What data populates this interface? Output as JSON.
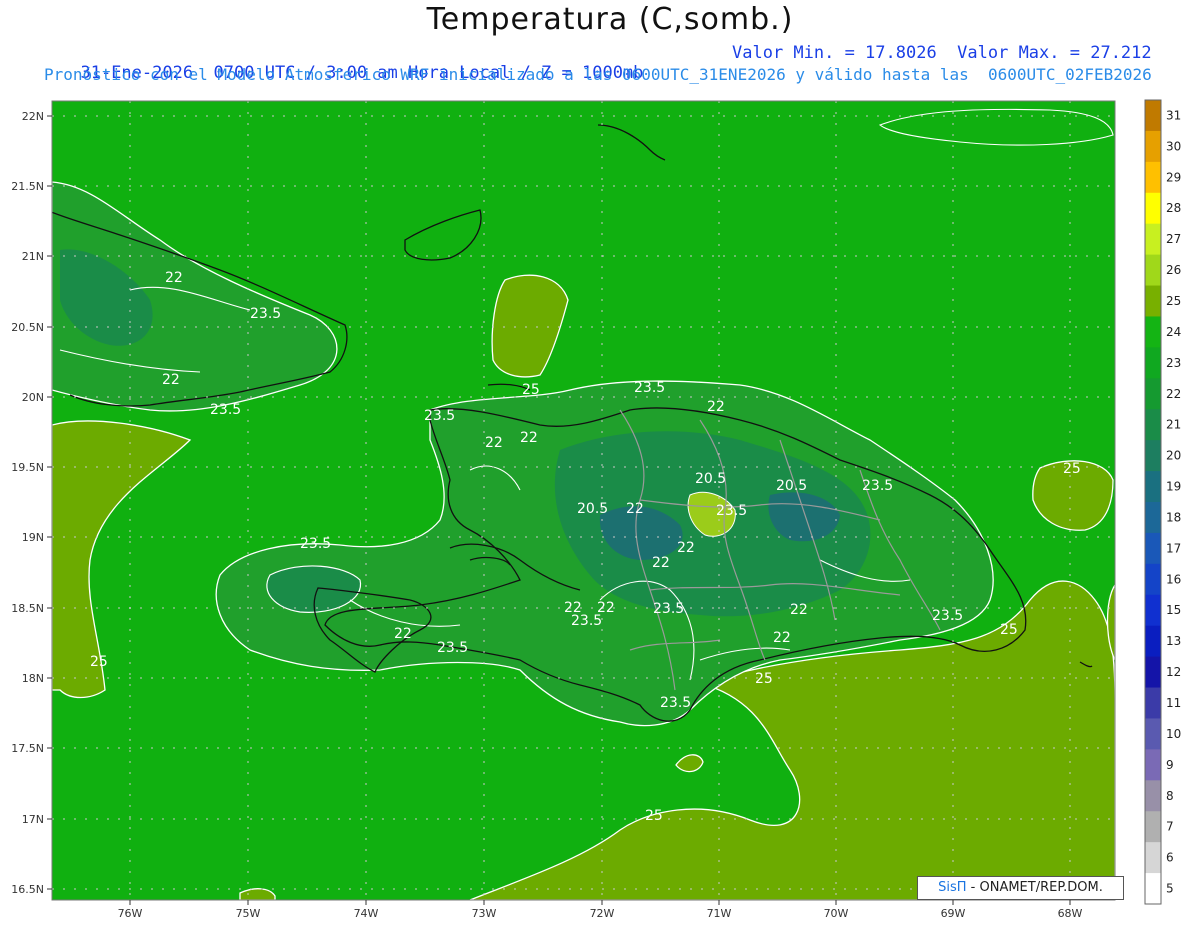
{
  "title": "Temperatura (C,somb.)",
  "subtitle_left": "31-Ene-2026  0700 UTC / 3:00 am Hora Local / Z = 1000mb",
  "subtitle_right": "Valor Min. = 17.8026  Valor Max. = 27.212",
  "subtitle2": "Pronóstico con el Modelo Atmosferico WRF inicializado a las 0600UTC_31ENE2026 y válido hasta las  0600UTC_02FEB2026",
  "lat_labels": [
    "22N",
    "21.5N",
    "21N",
    "20.5N",
    "20N",
    "19.5N",
    "19N",
    "18.5N",
    "18N",
    "17.5N",
    "17N",
    "16.5N"
  ],
  "lon_labels": [
    "76W",
    "75W",
    "74W",
    "73W",
    "72W",
    "71W",
    "70W",
    "69W",
    "68W"
  ],
  "colorbar": {
    "labels": [
      "31",
      "30",
      "29",
      "28",
      "27",
      "26",
      "25",
      "24",
      "23",
      "22",
      "21",
      "20",
      "19",
      "18",
      "17",
      "16",
      "15",
      "13",
      "12",
      "11",
      "10",
      "9",
      "8",
      "7",
      "6",
      "5"
    ],
    "colors": [
      "#c07a00",
      "#e6a000",
      "#ffc000",
      "#ffff00",
      "#c8f020",
      "#a0d81a",
      "#78b000",
      "#14b414",
      "#10a820",
      "#159a30",
      "#1a8c48",
      "#1d7e60",
      "#1a7080",
      "#1c6898",
      "#1a58b8",
      "#1444c8",
      "#1030d0",
      "#0a1ec0",
      "#1414a8",
      "#3b3ba8",
      "#5a5ab0",
      "#7a6ab5",
      "#9890a8",
      "#b0b0b0",
      "#d6d6d6",
      "#ffffff"
    ]
  },
  "contour_labels": [
    "22",
    "23.5",
    "22",
    "23.5",
    "25",
    "23.5",
    "22",
    "22",
    "22",
    "23.5",
    "20.5",
    "20.5",
    "23.5",
    "20.5",
    "22",
    "22",
    "23.5",
    "22",
    "22",
    "23.5",
    "22",
    "23.5",
    "22",
    "22",
    "23.5",
    "25",
    "25",
    "25",
    "25",
    "23.5",
    "22",
    "23.5",
    "23.5",
    "25"
  ],
  "credit": {
    "brand": "SisΠ",
    "text": " - ONAMET/REP.DOM."
  }
}
